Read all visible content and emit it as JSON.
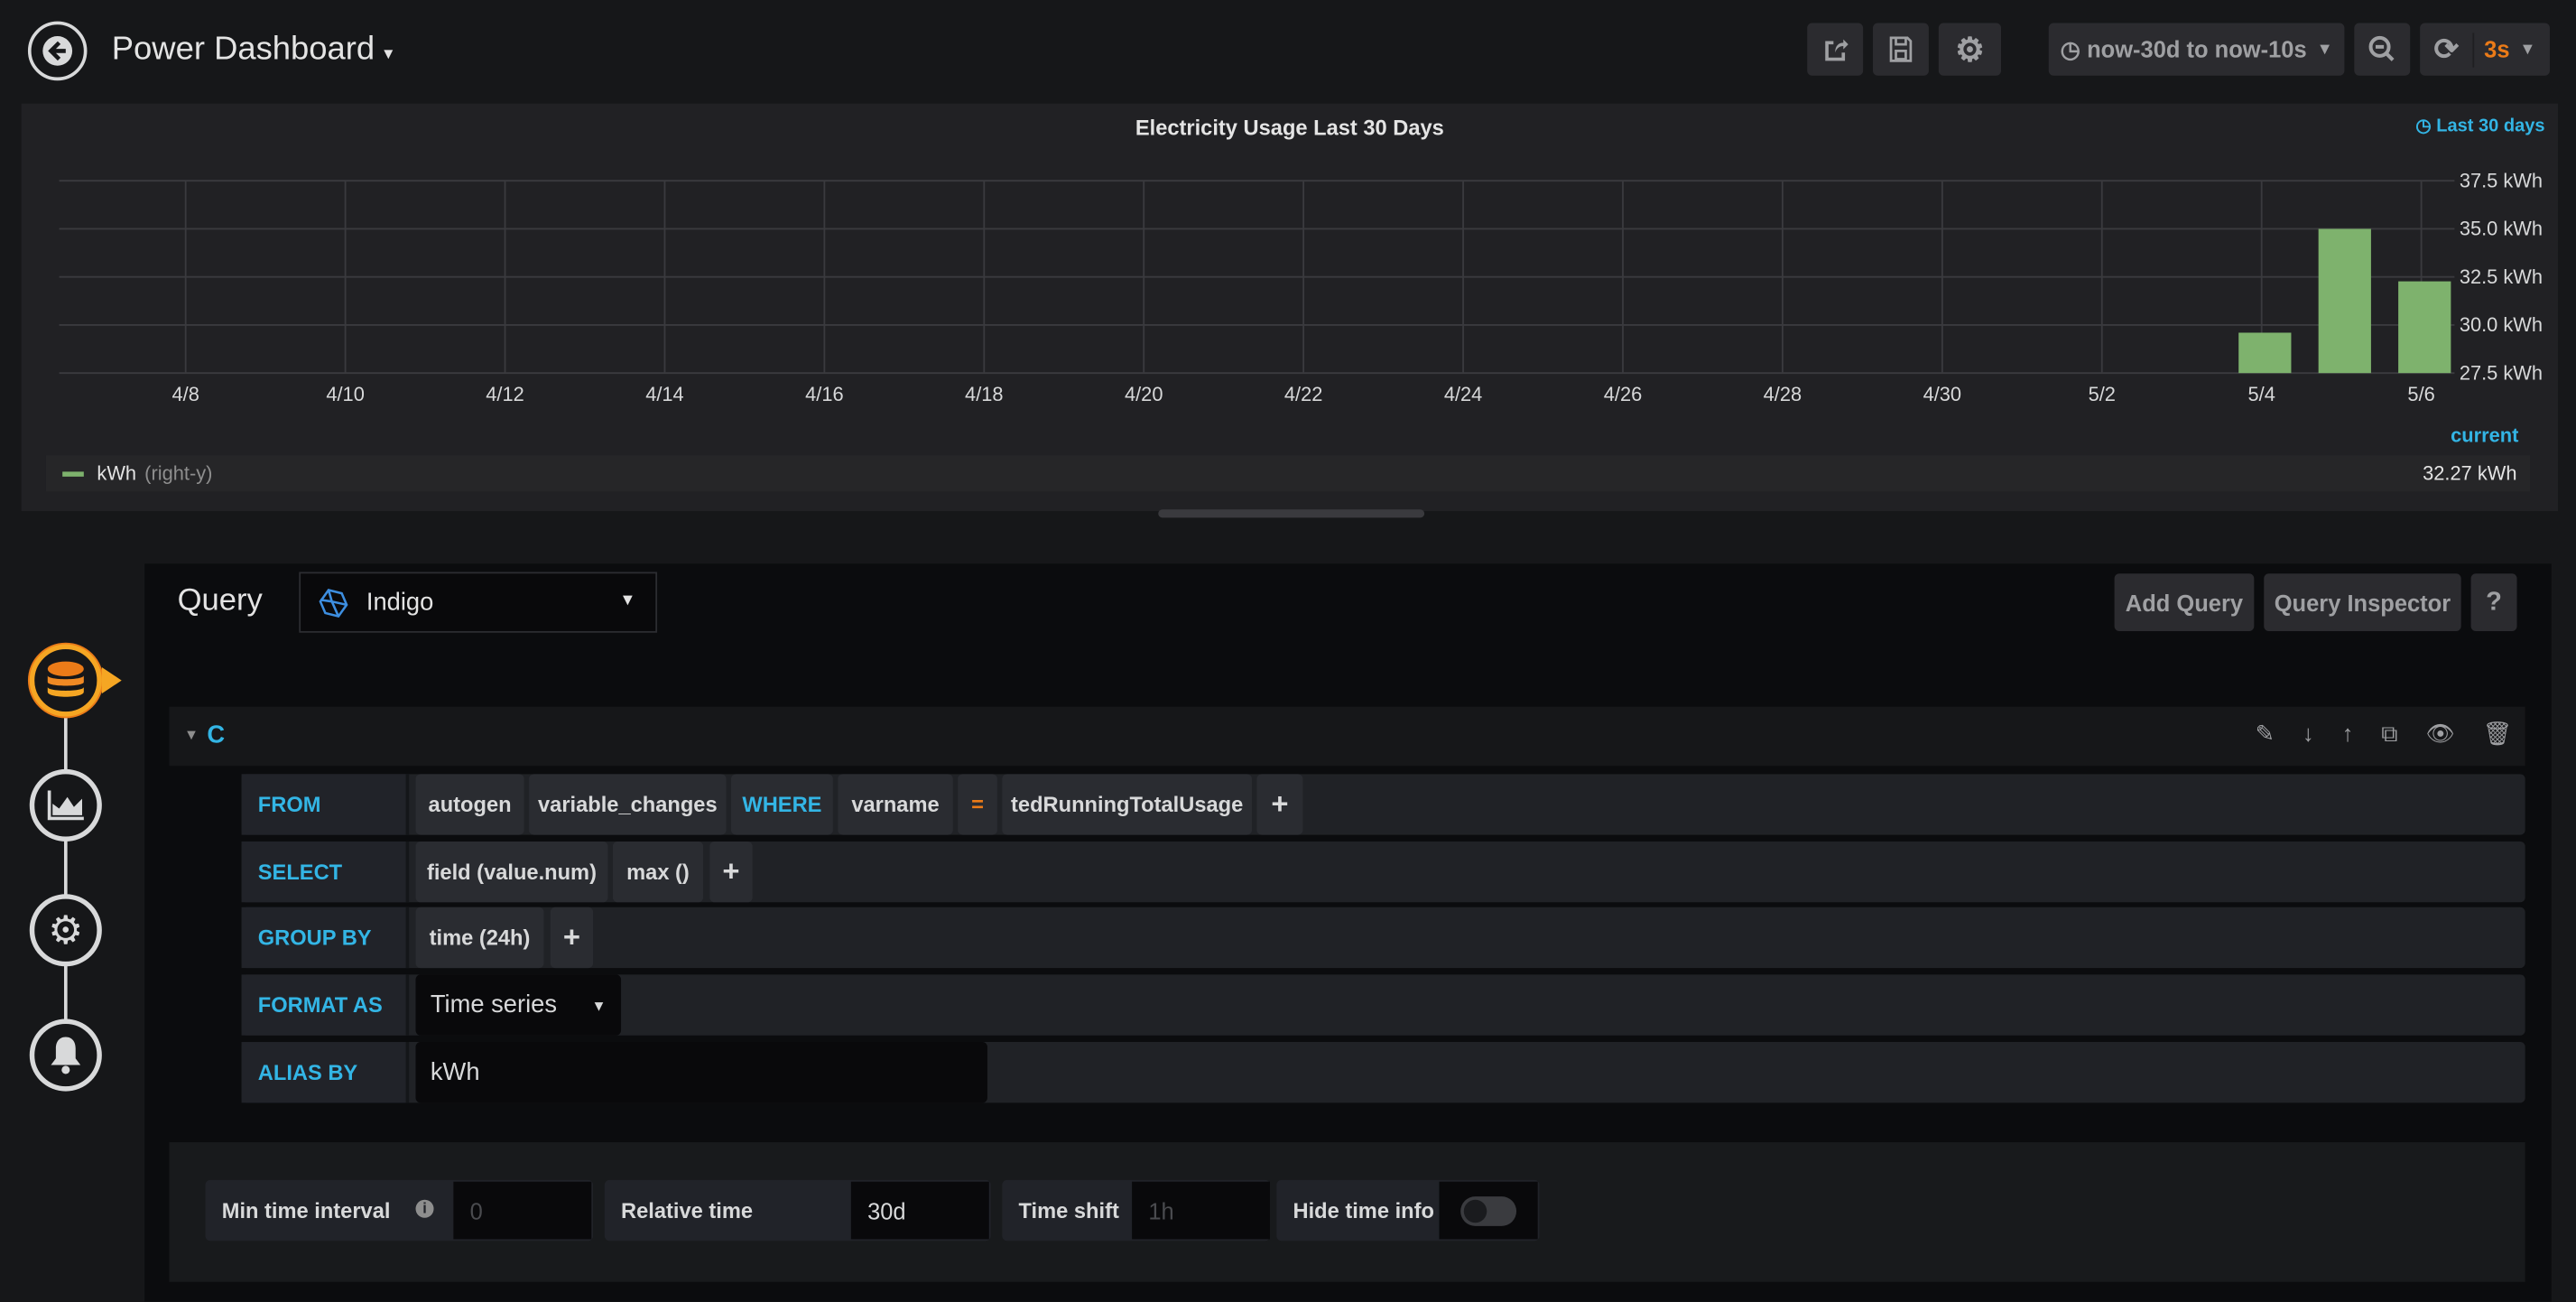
{
  "header": {
    "title": "Power Dashboard",
    "time_range": "now-30d to now-10s",
    "refresh_interval": "3s",
    "icons": [
      "back-arrow-icon",
      "share-icon",
      "save-icon",
      "gear-icon",
      "clock-icon",
      "zoom-out-icon",
      "refresh-icon"
    ]
  },
  "panel": {
    "title": "Electricity Usage Last 30 Days",
    "time_info": "Last 30 days",
    "legend": {
      "series": "kWh",
      "axis": "(right-y)",
      "current_header": "current",
      "current_value": "32.27 kWh"
    }
  },
  "chart_data": {
    "type": "bar",
    "title": "Electricity Usage Last 30 Days",
    "x_tick_labels": [
      "4/8",
      "4/10",
      "4/12",
      "4/14",
      "4/16",
      "4/18",
      "4/20",
      "4/22",
      "4/24",
      "4/26",
      "4/28",
      "4/30",
      "5/2",
      "5/4",
      "5/6"
    ],
    "y_tick_labels": [
      "37.5 kWh",
      "35.0 kWh",
      "32.5 kWh",
      "30.0 kWh",
      "27.5 kWh"
    ],
    "ylim": [
      27.5,
      37.5
    ],
    "y_axis_side": "right",
    "grid": true,
    "series": [
      {
        "name": "kWh",
        "color": "#7eb26d",
        "points": [
          {
            "x": "5/4",
            "y": 29.6
          },
          {
            "x": "5/5",
            "y": 35.0
          },
          {
            "x": "5/6",
            "y": 32.27
          }
        ]
      }
    ]
  },
  "query": {
    "title": "Query",
    "datasource": "Indigo",
    "add_query": "Add Query",
    "query_inspector": "Query Inspector",
    "help": "?",
    "ref_id": "C",
    "rows": {
      "from": {
        "label": "FROM",
        "policy": "autogen",
        "measurement": "variable_changes",
        "where": "WHERE",
        "tag": "varname",
        "op": "=",
        "value": "tedRunningTotalUsage",
        "add": "+"
      },
      "select": {
        "label": "SELECT",
        "field": "field (value.num)",
        "func": "max ()",
        "add": "+"
      },
      "group_by": {
        "label": "GROUP BY",
        "time": "time (24h)",
        "add": "+"
      },
      "format_as": {
        "label": "FORMAT AS",
        "value": "Time series"
      },
      "alias_by": {
        "label": "ALIAS BY",
        "value": "kWh"
      }
    },
    "options": {
      "min_interval_label": "Min time interval",
      "min_interval_placeholder": "0",
      "relative_time_label": "Relative time",
      "relative_time_value": "30d",
      "time_shift_label": "Time shift",
      "time_shift_placeholder": "1h",
      "hide_time_info_label": "Hide time info",
      "hide_time_info": false
    }
  },
  "colors": {
    "accent": "#33b5e5",
    "orange": "#eb7b18",
    "bar": "#7eb26d"
  }
}
